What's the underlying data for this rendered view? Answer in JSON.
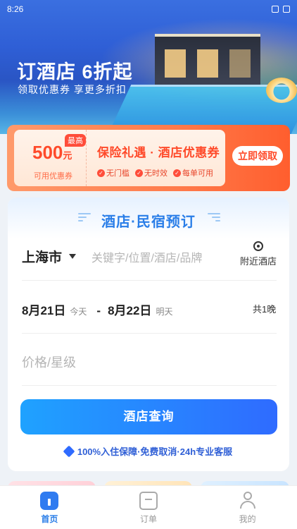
{
  "status_bar": {
    "time": "8:26"
  },
  "hero": {
    "title": "订酒店  6折起",
    "subtitle": "领取优惠券 享更多折扣"
  },
  "coupon": {
    "badge": "最高",
    "amount": "500",
    "unit": "元",
    "caption": "可用优惠券",
    "title": "保险礼遇 · 酒店优惠券",
    "tags": [
      "无门槛",
      "无时效",
      "每单可用"
    ],
    "claim_label": "立即领取"
  },
  "booking": {
    "title": "酒店·民宿预订",
    "city": "上海市",
    "search_placeholder": "关键字/位置/酒店/品牌",
    "nearby_label": "附近酒店",
    "checkin_date": "8月21日",
    "checkin_day": "今天",
    "separator": "-",
    "checkout_date": "8月22日",
    "checkout_day": "明天",
    "nights": "共1晚",
    "price_placeholder": "价格/星级",
    "search_button": "酒店查询",
    "guarantee": "100%入住保障·免费取消·24h专业客服"
  },
  "tabbar": {
    "tabs": [
      {
        "label": "首页",
        "icon": "home-icon",
        "active": true
      },
      {
        "label": "订单",
        "icon": "order-icon",
        "active": false
      },
      {
        "label": "我的",
        "icon": "user-icon",
        "active": false
      }
    ]
  },
  "colors": {
    "primary": "#2a7ee8",
    "coupon_orange": "#ff5e2e",
    "button_gradient_start": "#1fa2ff",
    "button_gradient_end": "#2f6bff"
  }
}
